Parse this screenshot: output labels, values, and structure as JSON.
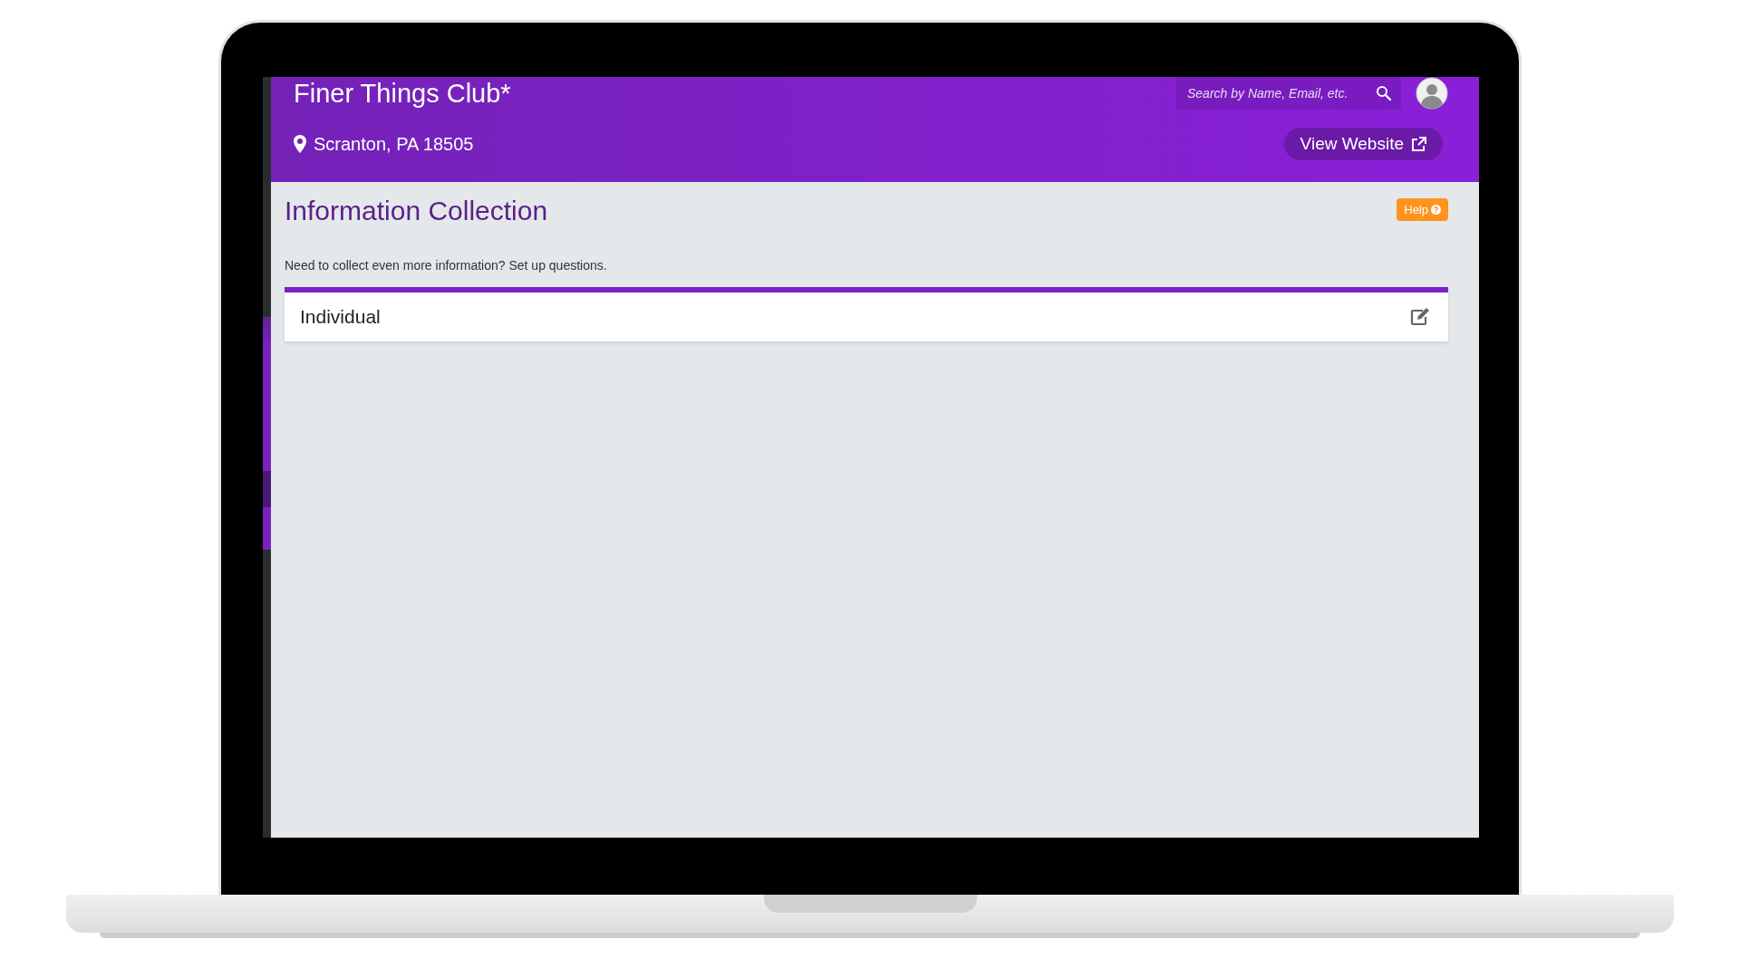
{
  "header": {
    "title": "Finer Things Club*",
    "location": "Scranton, PA 18505",
    "search": {
      "placeholder": "Search by Name, Email, etc."
    },
    "website_button": "View Website"
  },
  "page": {
    "heading": "Information Collection",
    "help_button": "Help",
    "description": "Need to collect even more information? Set up questions.",
    "cards": [
      {
        "title": "Individual"
      }
    ]
  }
}
